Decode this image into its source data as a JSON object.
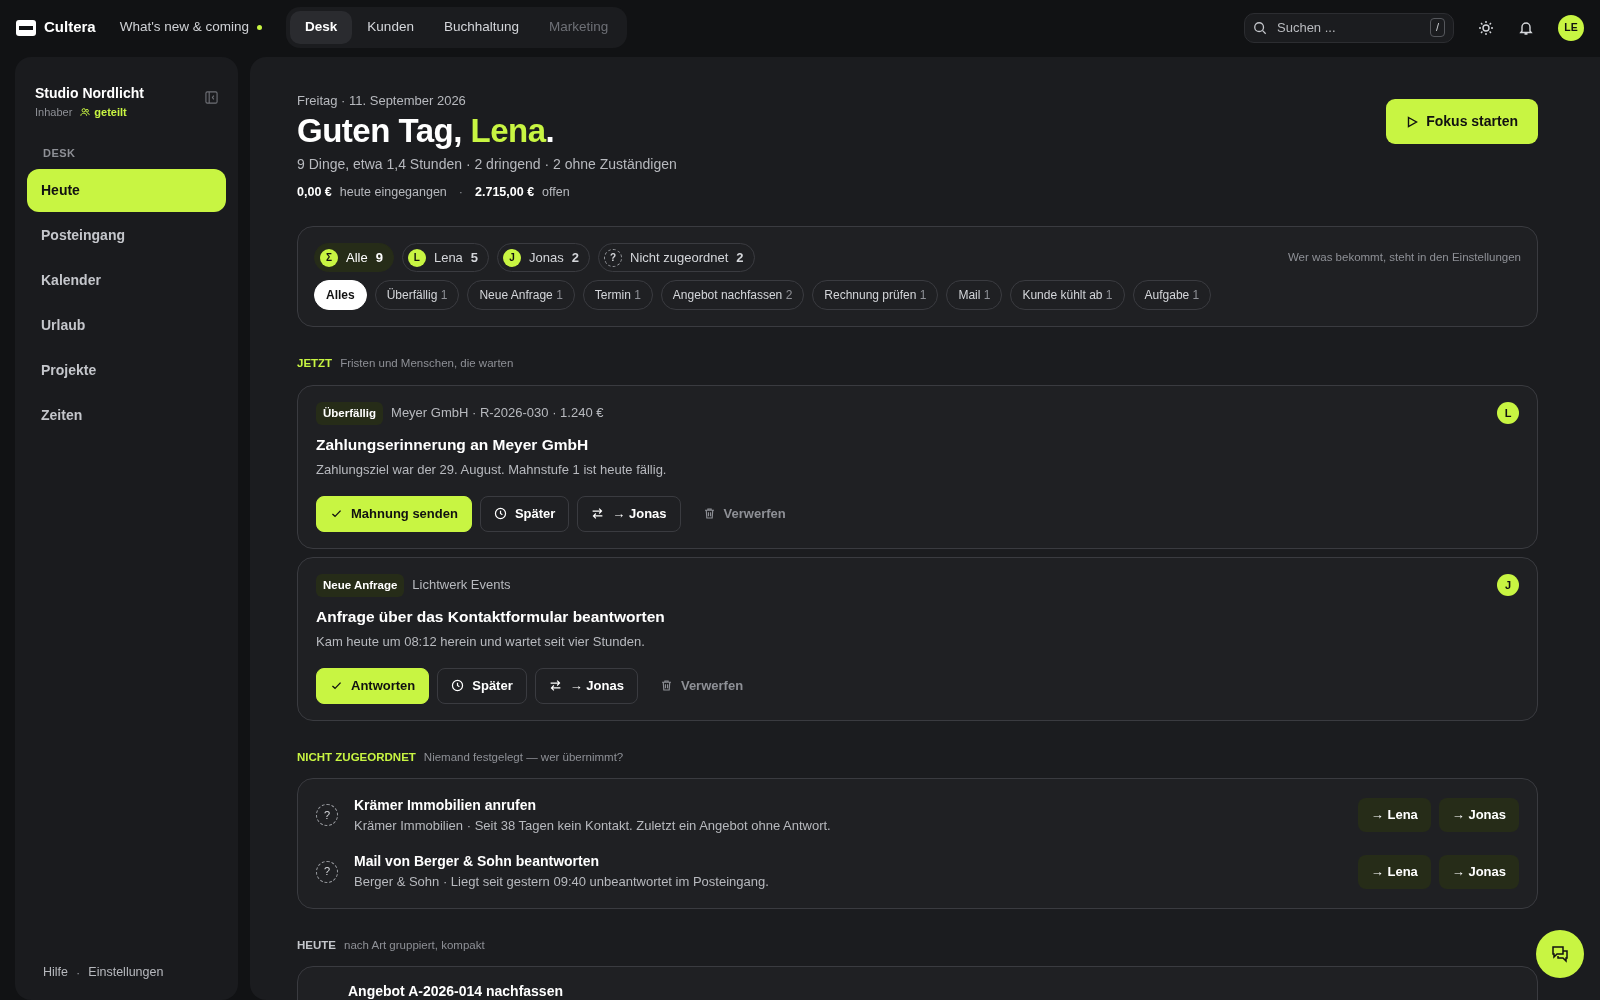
{
  "topbar": {
    "logo": "Cultera",
    "whats_new": {
      "label": "What's new & coming",
      "dot": true
    },
    "tabs": [
      {
        "label": "Desk",
        "selected": true,
        "disabled": false
      },
      {
        "label": "Kunden",
        "selected": false,
        "disabled": false
      },
      {
        "label": "Buchhaltung",
        "selected": false,
        "disabled": false
      },
      {
        "label": "Marketing",
        "selected": false,
        "disabled": true
      }
    ],
    "search": {
      "placeholder": "Suchen ...",
      "shortcut": "/"
    },
    "avatar": "LE"
  },
  "sidebar": {
    "workspace": "Studio Nordlicht",
    "role": "Inhaber",
    "shared": "geteilt",
    "section": "DESK",
    "items": [
      {
        "label": "Heute",
        "selected": true
      },
      {
        "label": "Posteingang",
        "selected": false
      },
      {
        "label": "Kalender",
        "selected": false
      },
      {
        "label": "Urlaub",
        "selected": false
      },
      {
        "label": "Projekte",
        "selected": false
      },
      {
        "label": "Zeiten",
        "selected": false
      }
    ],
    "footer_links": [
      "Hilfe",
      "Einstellungen"
    ],
    "footer_separator": "·"
  },
  "header": {
    "date": "Freitag · 11. September 2026",
    "greeting": "Guten Tag, ",
    "name": "Lena",
    "greeting_end": ".",
    "summary": "9 Dinge, etwa 1,4 Stunden · 2 dringend · 2 ohne Zuständigen",
    "totals": [
      {
        "amount": "0,00 €",
        "label": "heute eingegangen"
      },
      {
        "amount": "2.715,00 €",
        "label": "offen"
      }
    ],
    "totals_separator": "·",
    "focus_button": "Fokus starten"
  },
  "filters": {
    "people": [
      {
        "kind": "all",
        "initial": "Σ",
        "label": "Alle",
        "count": "9",
        "selected": true
      },
      {
        "kind": "person",
        "initial": "L",
        "label": "Lena",
        "count": "5",
        "selected": false
      },
      {
        "kind": "person",
        "initial": "J",
        "label": "Jonas",
        "count": "2",
        "selected": false
      },
      {
        "kind": "unassigned",
        "initial": "?",
        "label": "Nicht zugeordnet",
        "count": "2",
        "selected": false
      }
    ],
    "hint": "Wer was bekommt, steht in den Einstellungen",
    "categories": [
      {
        "label": "Alles",
        "selected": true
      },
      {
        "label": "Überfällig",
        "count": "1",
        "selected": false
      },
      {
        "label": "Neue Anfrage",
        "count": "1",
        "selected": false
      },
      {
        "label": "Termin",
        "count": "1",
        "selected": false
      },
      {
        "label": "Angebot nachfassen",
        "count": "2",
        "selected": false
      },
      {
        "label": "Rechnung prüfen",
        "count": "1",
        "selected": false
      },
      {
        "label": "Mail",
        "count": "1",
        "selected": false
      },
      {
        "label": "Kunde kühlt ab",
        "count": "1",
        "selected": false
      },
      {
        "label": "Aufgabe",
        "count": "1",
        "selected": false
      }
    ]
  },
  "sections": [
    {
      "kind": "tasks",
      "title": "JETZT",
      "subtitle": "Fristen und Menschen, die warten",
      "accent": true,
      "items": [
        {
          "tag": "Überfällig",
          "meta": "Meyer GmbH · R-2026-030 · 1.240 €",
          "title": "Zahlungserinnerung an Meyer GmbH",
          "description": "Zahlungsziel war der 29. August. Mahnstufe 1 ist heute fällig.",
          "assignee": "L",
          "actions": [
            {
              "kind": "primary",
              "label": "Mahnung senden"
            },
            {
              "kind": "later",
              "label": "Später"
            },
            {
              "kind": "reassign",
              "label": "→ Jonas"
            },
            {
              "kind": "discard",
              "label": "Verwerfen"
            }
          ]
        },
        {
          "tag": "Neue Anfrage",
          "meta": "Lichtwerk Events",
          "title": "Anfrage über das Kontaktformular beantworten",
          "description": "Kam heute um 08:12 herein und wartet seit vier Stunden.",
          "assignee": "J",
          "actions": [
            {
              "kind": "primary",
              "label": "Antworten"
            },
            {
              "kind": "later",
              "label": "Später"
            },
            {
              "kind": "reassign",
              "label": "→ Jonas"
            },
            {
              "kind": "discard",
              "label": "Verwerfen"
            }
          ]
        }
      ]
    },
    {
      "kind": "unassigned",
      "title": "NICHT ZUGEORDNET",
      "subtitle": "Niemand festgelegt — wer übernimmt?",
      "accent": true,
      "items": [
        {
          "icon": "?",
          "title": "Krämer Immobilien anrufen",
          "description": "Krämer Immobilien · Seit 38 Tagen kein Kontakt. Zuletzt ein Angebot ohne Antwort.",
          "buttons": [
            "→ Lena",
            "→ Jonas"
          ]
        },
        {
          "icon": "?",
          "title": "Mail von Berger & Sohn beantworten",
          "description": "Berger & Sohn · Liegt seit gestern 09:40 unbeantwortet im Posteingang.",
          "buttons": [
            "→ Lena",
            "→ Jonas"
          ]
        }
      ]
    },
    {
      "kind": "compact",
      "title": "HEUTE",
      "subtitle": "nach Art gruppiert, kompakt",
      "accent": false,
      "items": [
        {
          "title": "Angebot A-2026-014 nachfassen"
        }
      ]
    }
  ]
}
